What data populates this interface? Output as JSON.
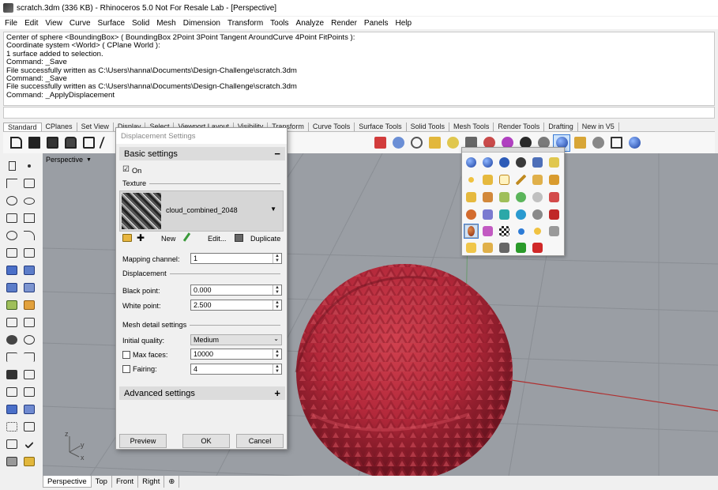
{
  "window": {
    "title": "scratch.3dm (336 KB) - Rhinoceros 5.0 Not For Resale Lab - [Perspective]"
  },
  "menu": [
    "File",
    "Edit",
    "View",
    "Curve",
    "Surface",
    "Solid",
    "Mesh",
    "Dimension",
    "Transform",
    "Tools",
    "Analyze",
    "Render",
    "Panels",
    "Help"
  ],
  "command_history": [
    "Center of sphere <BoundingBox> ( BoundingBox 2Point 3Point Tangent AroundCurve 4Point FitPoints ):",
    "Coordinate system <World> ( CPlane World ):",
    "1 surface added to selection.",
    "Command: _Save",
    "File successfully written as C:\\Users\\hanna\\Documents\\Design-Challenge\\scratch.3dm",
    "Command: _Save",
    "File successfully written as C:\\Users\\hanna\\Documents\\Design-Challenge\\scratch.3dm",
    "Command: _ApplyDisplacement"
  ],
  "toolbar_tabs": [
    "Standard",
    "CPlanes",
    "Set View",
    "Display",
    "Select",
    "Viewport Layout",
    "Visibility",
    "Transform",
    "Curve Tools",
    "Surface Tools",
    "Solid Tools",
    "Mesh Tools",
    "Render Tools",
    "Drafting",
    "New in V5"
  ],
  "viewport": {
    "label": "Perspective",
    "axis_z": "z",
    "axis_y": "y",
    "axis_x": "x"
  },
  "bottom_tabs": [
    "Perspective",
    "Top",
    "Front",
    "Right"
  ],
  "dialog": {
    "title": "Displacement Settings",
    "basic_header": "Basic settings",
    "basic_sign": "−",
    "on_label": "On",
    "on_checked": "☑",
    "texture_group": "Texture",
    "texture_name": "cloud_combined_2048",
    "texture_arrow": "▼",
    "new_label": "New",
    "edit_label": "Edit...",
    "duplicate_label": "Duplicate",
    "mapping_label": "Mapping channel:",
    "mapping_value": "1",
    "displacement_group": "Displacement",
    "black_label": "Black point:",
    "black_value": "0.000",
    "white_label": "White point:",
    "white_value": "2.500",
    "mesh_group": "Mesh detail settings",
    "quality_label": "Initial quality:",
    "quality_value": "Medium",
    "maxfaces_label": "Max faces:",
    "maxfaces_value": "10000",
    "fairing_label": "Fairing:",
    "fairing_value": "4",
    "advanced_header": "Advanced settings",
    "advanced_sign": "+",
    "preview_label": "Preview",
    "ok_label": "OK",
    "cancel_label": "Cancel"
  },
  "colors": {
    "sphere": "#b3283a",
    "viewport_bg": "#9a9ea4",
    "grid": "#8a8e94",
    "x_axis": "#b03030",
    "selection": "#3a7bd5"
  }
}
